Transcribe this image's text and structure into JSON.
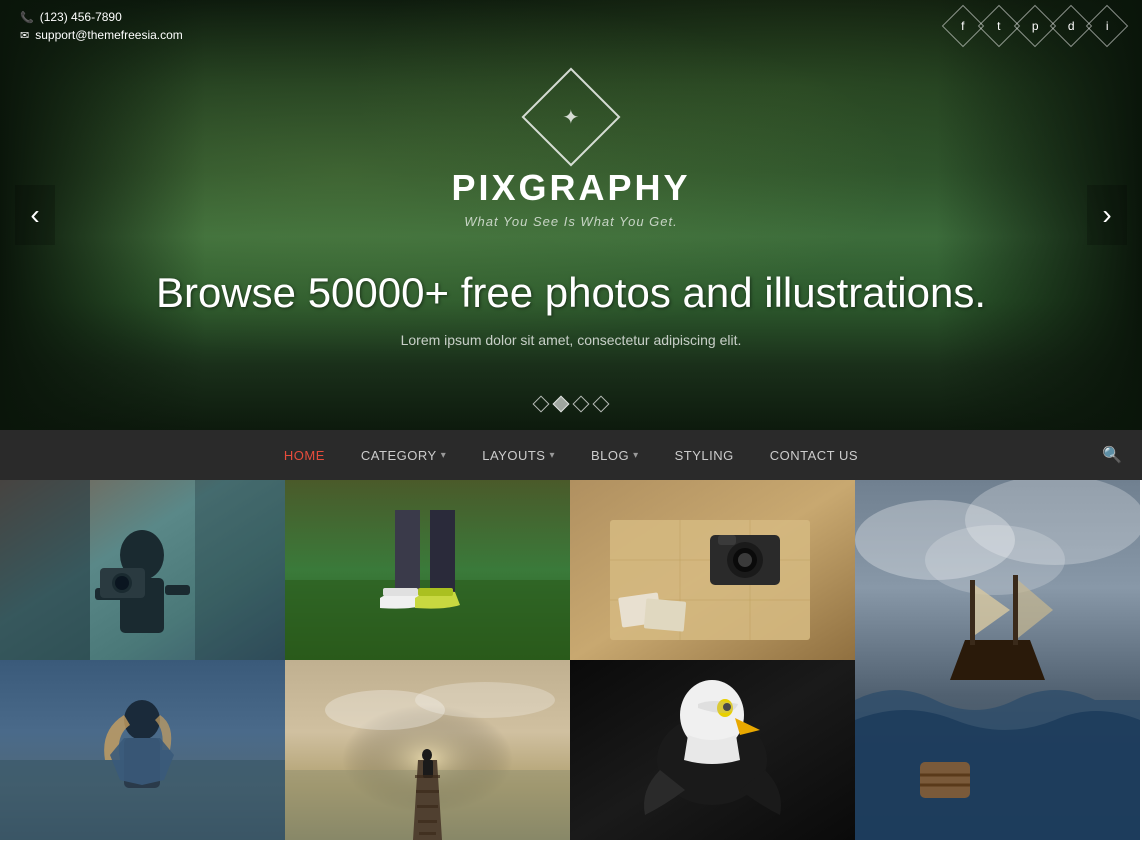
{
  "contact": {
    "phone": "(123) 456-7890",
    "email": "support@themefreesia.com"
  },
  "site": {
    "title": "PIXGRAPHY",
    "tagline": "What You See Is What You Get.",
    "logo_symbol": "✦"
  },
  "hero": {
    "headline": "Browse 50000+ free photos and illustrations.",
    "subtext": "Lorem ipsum dolor sit amet, consectetur adipiscing elit.",
    "prev_label": "‹",
    "next_label": "›",
    "dots": [
      {
        "active": false
      },
      {
        "active": true
      },
      {
        "active": false
      },
      {
        "active": false
      }
    ]
  },
  "nav": {
    "items": [
      {
        "label": "HOME",
        "active": true,
        "has_dropdown": false
      },
      {
        "label": "CATEGORY",
        "active": false,
        "has_dropdown": true
      },
      {
        "label": "LAYOUTS",
        "active": false,
        "has_dropdown": true
      },
      {
        "label": "BLOG",
        "active": false,
        "has_dropdown": true
      },
      {
        "label": "STYLING",
        "active": false,
        "has_dropdown": false
      },
      {
        "label": "CONTACT US",
        "active": false,
        "has_dropdown": false
      }
    ],
    "search_tooltip": "Search"
  },
  "social": {
    "icons": [
      {
        "name": "facebook-icon",
        "symbol": "f"
      },
      {
        "name": "twitter-icon",
        "symbol": "t"
      },
      {
        "name": "pinterest-icon",
        "symbol": "p"
      },
      {
        "name": "dribbble-icon",
        "symbol": "d"
      },
      {
        "name": "instagram-icon",
        "symbol": "i"
      }
    ]
  },
  "photos": [
    {
      "id": 1,
      "class": "photo-1",
      "alt": "Photographer with camera"
    },
    {
      "id": 2,
      "class": "photo-2",
      "alt": "Sneakers on grass"
    },
    {
      "id": 3,
      "class": "photo-3",
      "alt": "Camera on map with photos"
    },
    {
      "id": 4,
      "class": "photo-4",
      "alt": "Tall ship in storm",
      "tall": true
    },
    {
      "id": 5,
      "class": "photo-5",
      "alt": "Girl looking at sea"
    },
    {
      "id": 6,
      "class": "photo-6",
      "alt": "Person on pier at sunset"
    },
    {
      "id": 7,
      "class": "photo-7",
      "alt": "Bald eagle portrait"
    }
  ]
}
